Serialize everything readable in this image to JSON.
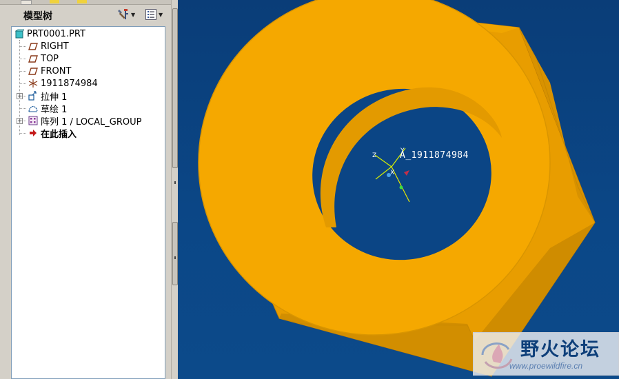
{
  "panel": {
    "title": "模型树",
    "settings_icon": "tools-icon",
    "show_icon": "list-icon"
  },
  "tree": {
    "items": [
      {
        "label": "PRT0001.PRT",
        "icon": "part-icon"
      },
      {
        "label": "RIGHT",
        "icon": "datum-plane-icon"
      },
      {
        "label": "TOP",
        "icon": "datum-plane-icon"
      },
      {
        "label": "FRONT",
        "icon": "datum-plane-icon"
      },
      {
        "label": "1911874984",
        "icon": "csys-icon"
      },
      {
        "label": "拉伸 1",
        "icon": "extrude-icon"
      },
      {
        "label": "草绘 1",
        "icon": "sketch-icon"
      },
      {
        "label": "阵列 1 / LOCAL_GROUP",
        "icon": "pattern-icon"
      },
      {
        "label": "在此插入",
        "icon": "insert-arrow-icon"
      }
    ]
  },
  "viewport": {
    "csys_label": "A_1911874984",
    "model_color": "#f5a800",
    "background_color": "#0b4585"
  },
  "watermark": {
    "title": "野火论坛",
    "url": "www.proewildfire.cn"
  }
}
